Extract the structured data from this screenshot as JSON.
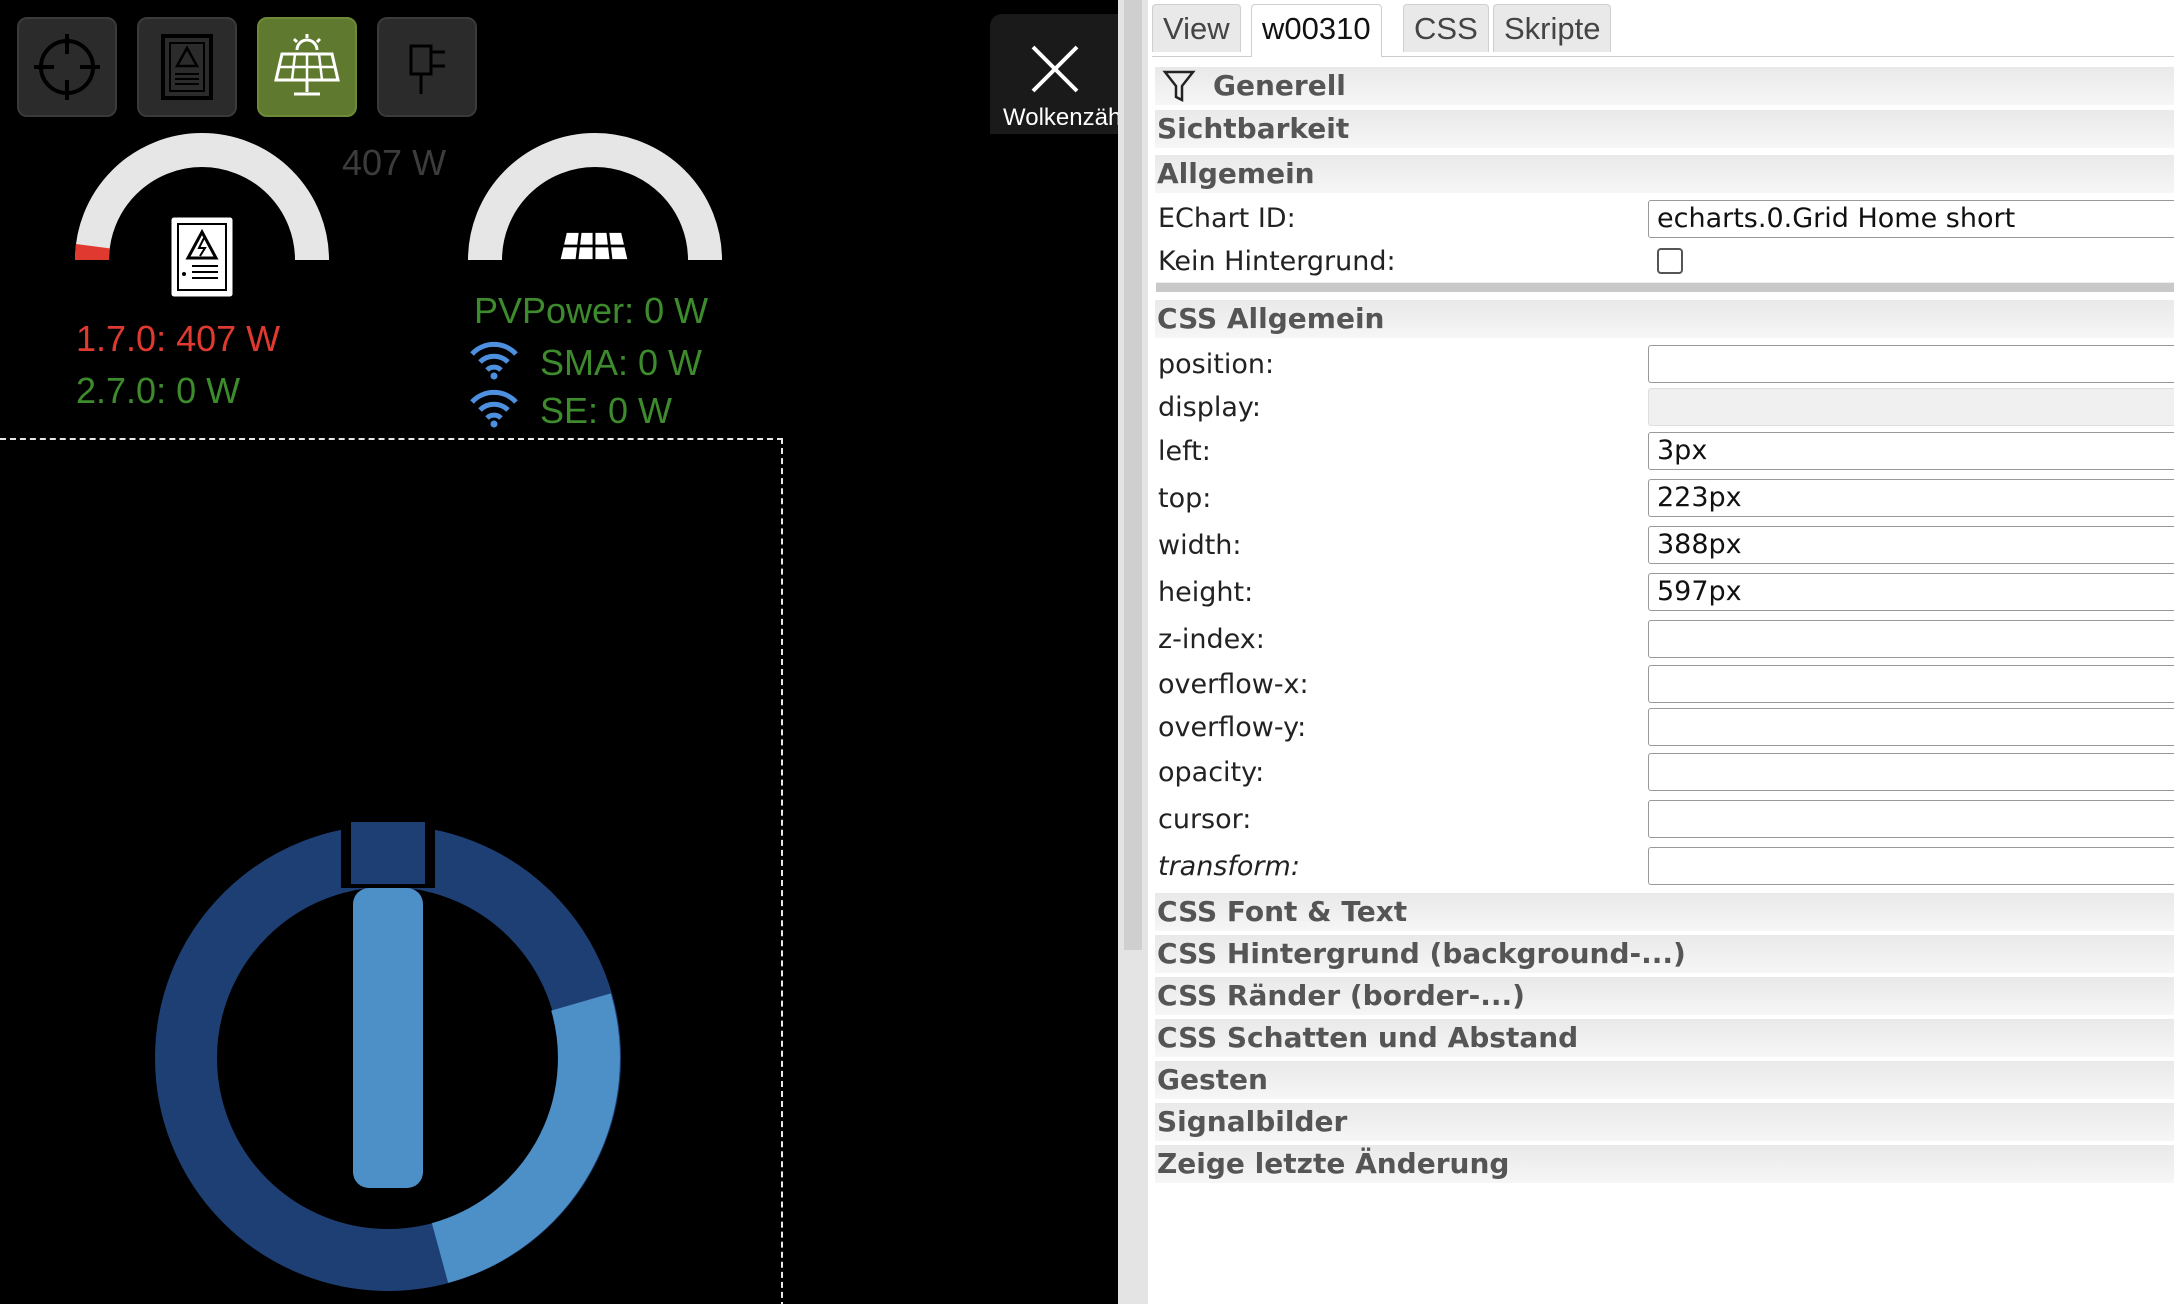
{
  "canvas": {
    "nav_buttons": [
      {
        "icon": "crosshair-icon",
        "active": false
      },
      {
        "icon": "electric-cabinet-icon",
        "active": false
      },
      {
        "icon": "solar-panel-icon",
        "active": true
      },
      {
        "icon": "plug-icon",
        "active": false
      }
    ],
    "top_power_label": "407 W",
    "close_label": "Wolkenzäh",
    "grid": {
      "gauge_fraction": 0.04,
      "import_label": "1.7.0: 407 W",
      "export_label": "2.7.0: 0 W"
    },
    "pv": {
      "gauge_fraction": 0.0,
      "power_label": "PVPower: 0 W",
      "sma_label": "SMA: 0 W",
      "se_label": "SE: 0 W"
    },
    "colors": {
      "red": "#e0392f",
      "green": "#3d8b2d",
      "wifi": "#4d90e0",
      "ring_dark": "#1e3f73",
      "ring_light": "#4d8fc7",
      "active_button": "#5f7a2f"
    }
  },
  "panel": {
    "tabs": [
      {
        "label": "View",
        "active": false
      },
      {
        "label": "w00310",
        "active": true
      },
      {
        "label": "CSS",
        "active": false
      },
      {
        "label": "Skripte",
        "active": false
      }
    ],
    "sections": {
      "generell": "Generell",
      "sichtbarkeit": "Sichtbarkeit",
      "allgemein": "Allgemein",
      "css_allgemein": "CSS Allgemein",
      "css_font": "CSS Font & Text",
      "css_hintergrund": "CSS Hintergrund (background-...)",
      "css_raender": "CSS Ränder (border-...)",
      "css_schatten": "CSS Schatten und Abstand",
      "gesten": "Gesten",
      "signalbilder": "Signalbilder",
      "letzte_aenderung": "Zeige letzte Änderung"
    },
    "allgemein": {
      "echart_id_label": "EChart ID:",
      "echart_id_value": "echarts.0.Grid Home short",
      "kein_hintergrund_label": "Kein Hintergrund:",
      "kein_hintergrund_checked": false
    },
    "css": {
      "position": {
        "label": "position:",
        "value": ""
      },
      "display": {
        "label": "display:",
        "value": ""
      },
      "left": {
        "label": "left:",
        "value": "3px"
      },
      "top": {
        "label": "top:",
        "value": "223px"
      },
      "width": {
        "label": "width:",
        "value": "388px"
      },
      "height": {
        "label": "height:",
        "value": "597px"
      },
      "z_index": {
        "label": "z-index:",
        "value": ""
      },
      "overflow_x": {
        "label": "overflow-x:",
        "value": ""
      },
      "overflow_y": {
        "label": "overflow-y:",
        "value": ""
      },
      "opacity": {
        "label": "opacity:",
        "value": ""
      },
      "cursor": {
        "label": "cursor:",
        "value": ""
      },
      "transform": {
        "label": "transform:",
        "value": ""
      }
    }
  }
}
